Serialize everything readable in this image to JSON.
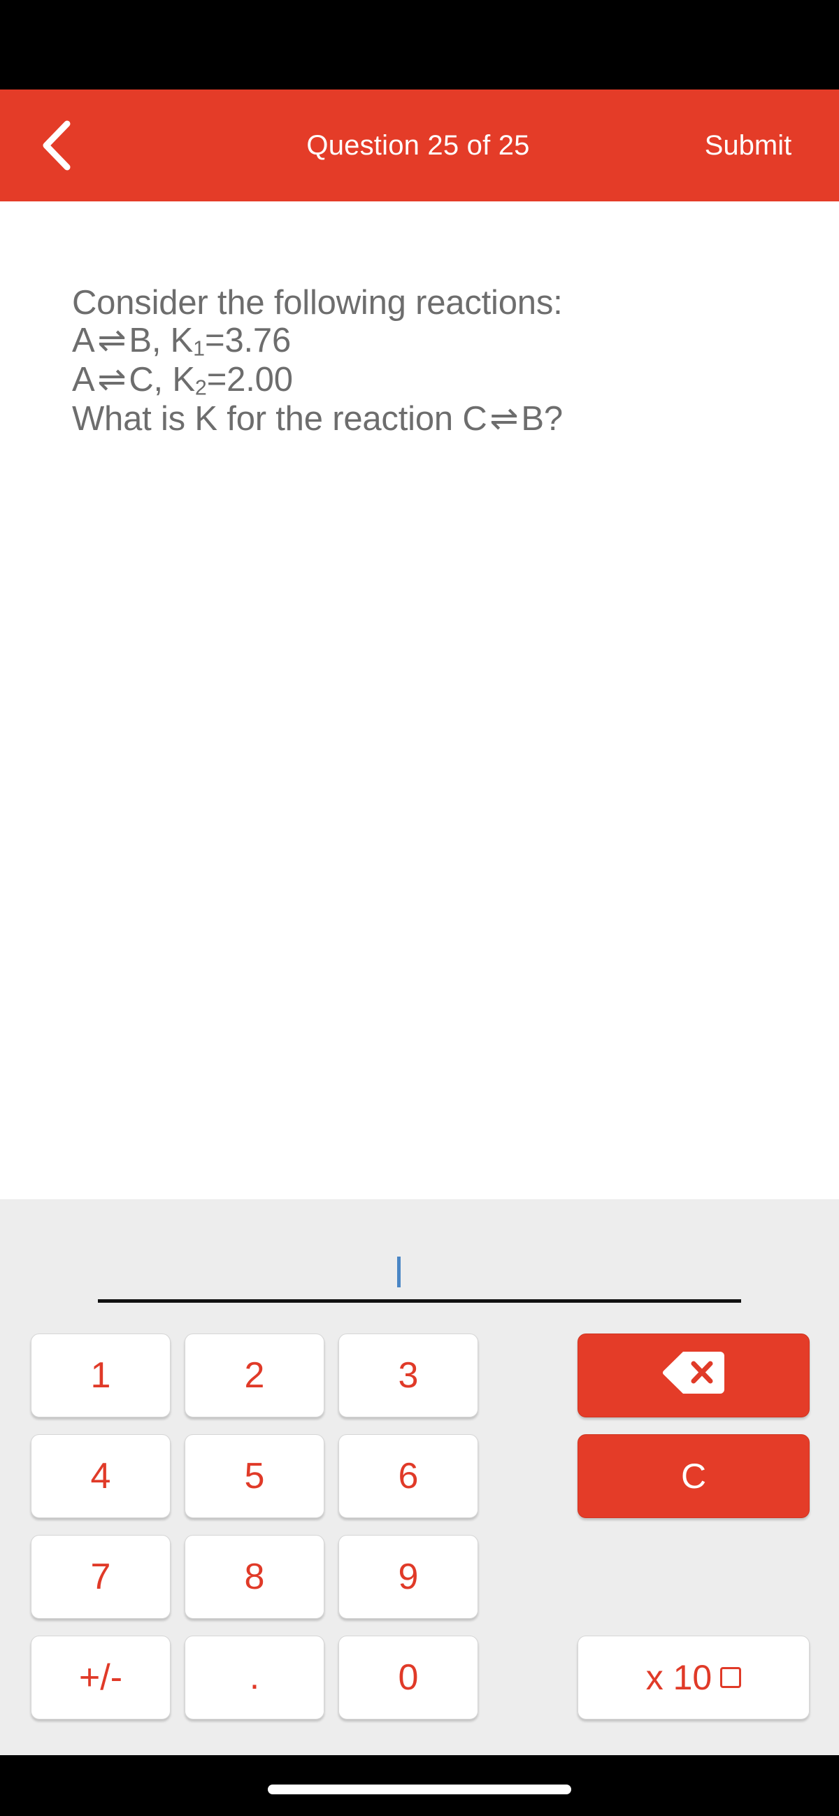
{
  "theme": {
    "accent": "#E43C28",
    "accent_text": "#E03A28",
    "question_text": "#6d6d6d",
    "keypad_bg": "#ededed",
    "caret": "#4a86c5",
    "chrome": "#000000"
  },
  "header": {
    "back_icon": "chevron-left-icon",
    "title": "Question 25 of 25",
    "submit_label": "Submit"
  },
  "question": {
    "intro": "Consider the following reactions:",
    "reaction1": {
      "reactant": "A",
      "arrow": "⇌",
      "product": "B",
      "separator": ", ",
      "constant": "K",
      "subscript": "1",
      "equals": "=",
      "value": "3.76"
    },
    "reaction2": {
      "reactant": "A",
      "arrow": "⇌",
      "product": "C",
      "separator": ", ",
      "constant": "K",
      "subscript": "2",
      "equals": "=",
      "value": "2.00"
    },
    "prompt_prefix": "What is K for the reaction C",
    "prompt_arrow": "⇌",
    "prompt_suffix": "B?"
  },
  "answer": {
    "value": "",
    "placeholder": "",
    "caret_visible": true
  },
  "keypad": {
    "digits": [
      {
        "label": "1",
        "name": "key-1"
      },
      {
        "label": "2",
        "name": "key-2"
      },
      {
        "label": "3",
        "name": "key-3"
      },
      {
        "label": "4",
        "name": "key-4"
      },
      {
        "label": "5",
        "name": "key-5"
      },
      {
        "label": "6",
        "name": "key-6"
      },
      {
        "label": "7",
        "name": "key-7"
      },
      {
        "label": "8",
        "name": "key-8"
      },
      {
        "label": "9",
        "name": "key-9"
      },
      {
        "label": "+/-",
        "name": "key-sign"
      },
      {
        "label": ".",
        "name": "key-decimal"
      },
      {
        "label": "0",
        "name": "key-0"
      }
    ],
    "backspace": {
      "icon": "backspace-delete-icon",
      "label": ""
    },
    "clear": {
      "label": "C",
      "name": "key-clear"
    },
    "exponent": {
      "label": "x 10",
      "box": "exponent-placeholder-box",
      "name": "key-exponent"
    }
  }
}
